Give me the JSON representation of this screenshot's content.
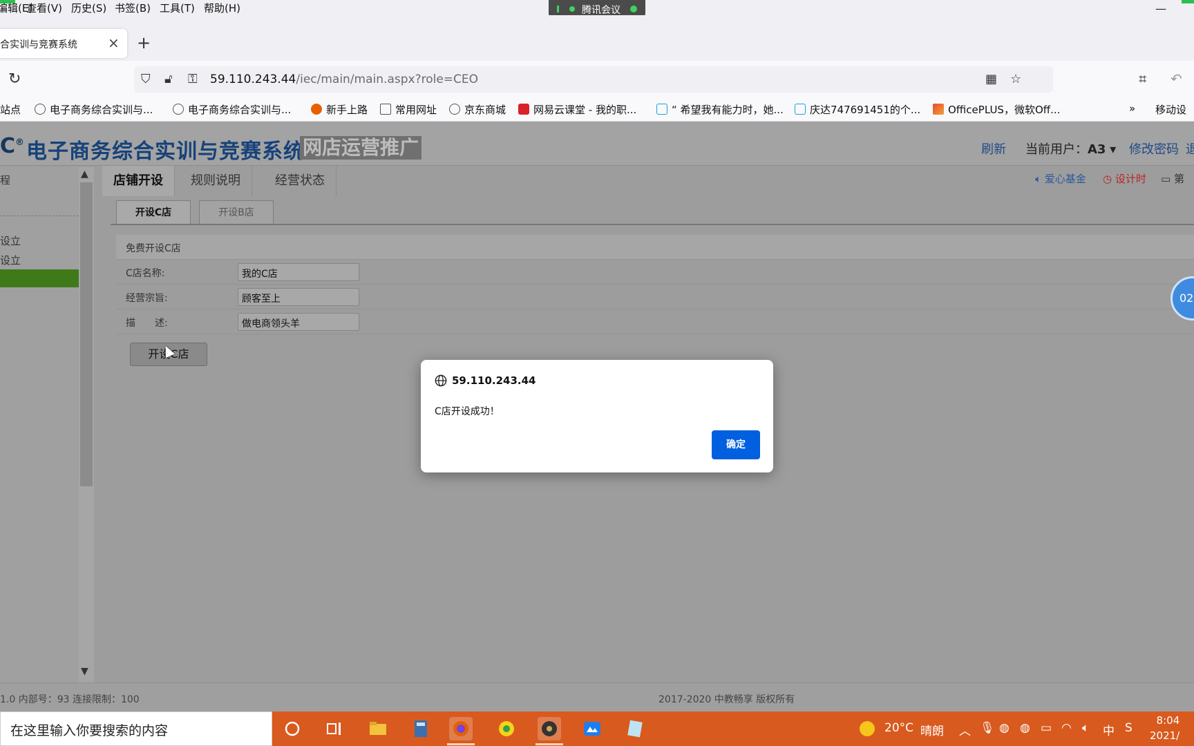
{
  "menubar": {
    "items": [
      "编辑(E)",
      "查看(V)",
      "历史(S)",
      "书签(B)",
      "工具(T)",
      "帮助(H)"
    ],
    "meeting_label": "腾讯会议"
  },
  "tab": {
    "title": "合实训与竞赛系统"
  },
  "address": {
    "host": "59.110.243.44",
    "path": "/iec/main/main.aspx?role=CEO"
  },
  "bookmarks": [
    "站点",
    "电子商务综合实训与...",
    "电子商务综合实训与...",
    "新手上路",
    "常用网址",
    "京东商城",
    "网易云课堂 - 我的职...",
    "“ 希望我有能力时，她...",
    "庆达747691451的个...",
    "OfficePLUS，微软Off...",
    "移动设"
  ],
  "site": {
    "logo_text": "C",
    "logo_mark": "®",
    "title": "电子商务综合实训与竞赛系统",
    "subtitle": "网店运营推广",
    "refresh": "刷新",
    "current_user_label": "当前用户：",
    "current_user": "A3",
    "change_password": "修改密码",
    "logout": "退"
  },
  "sidebar": {
    "items": [
      "程",
      "",
      "设立",
      "设立",
      ""
    ]
  },
  "main_tabs": [
    "店铺开设",
    "规则说明",
    "经营状态"
  ],
  "right_links": {
    "fund": "爱心基金",
    "timer": "设计时",
    "period": "第"
  },
  "sub_tabs": [
    "开设C店",
    "开设B店"
  ],
  "form": {
    "section_title": "免费开设C店",
    "rows": [
      {
        "label": "C店名称:",
        "value": "我的C店"
      },
      {
        "label": "经营宗旨:",
        "value": "顾客至上"
      },
      {
        "label": "描　　述:",
        "value": "做电商领头羊"
      }
    ],
    "submit_label": "开设C店"
  },
  "timer_bubble": "02:",
  "footer": {
    "left": "1.0 内部号：93 连接限制：100",
    "center": "2017-2020 中教畅享 版权所有"
  },
  "dialog": {
    "host": "59.110.243.44",
    "message": "C店开设成功！",
    "ok_label": "确定"
  },
  "taskbar": {
    "search_placeholder": "在这里输入你要搜索的内容",
    "temperature": "20°C",
    "weather": "晴朗",
    "ime": "中",
    "time": "8:04",
    "date": "2021/"
  }
}
